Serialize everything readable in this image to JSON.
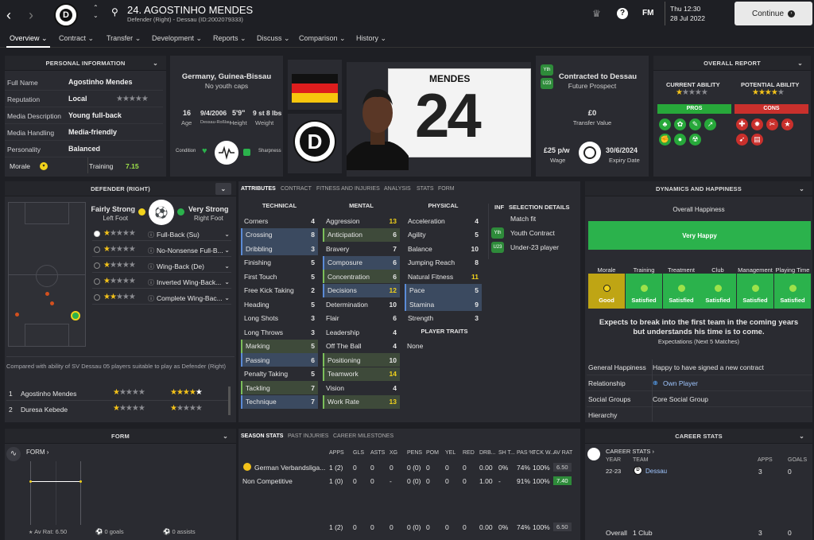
{
  "header": {
    "player_title": "24. AGOSTINHO MENDES",
    "player_sub": "Defender (Right) - Dessau (ID:2002079333)",
    "fm_label": "FM",
    "date_day": "Thu 12:30",
    "date": "28 Jul 2022",
    "continue_label": "Continue"
  },
  "tabs": [
    "Overview",
    "Contract",
    "Transfer",
    "Development",
    "Reports",
    "Discuss",
    "Comparison",
    "History"
  ],
  "personal": {
    "title": "PERSONAL INFORMATION",
    "rows": [
      {
        "k": "Full Name",
        "v": "Agostinho Mendes"
      },
      {
        "k": "Reputation",
        "v": "Local"
      },
      {
        "k": "Media Description",
        "v": "Young full-back"
      },
      {
        "k": "Media Handling",
        "v": "Media-friendly"
      },
      {
        "k": "Personality",
        "v": "Balanced"
      }
    ],
    "reputation_stars": "★★★★★",
    "morale_label": "Morale",
    "training_label": "Training",
    "training_value": "7.15"
  },
  "bio": {
    "nation": "Germany, Guinea-Bissau",
    "caps": "No youth caps",
    "age": "16",
    "age_label": "Age",
    "dob": "9/4/2006",
    "dob_label": "Dessau-Roßlau",
    "height": "5'9\"",
    "height_label": "Height",
    "weight": "9 st 8 lbs",
    "weight_label": "Weight",
    "condition_label": "Condition",
    "sharpness_label": "Sharpness"
  },
  "shirt": {
    "name": "MENDES",
    "number": "24"
  },
  "contract": {
    "badge1": "Yth",
    "badge2": "U23",
    "title": "Contracted to Dessau",
    "sub": "Future Prospect",
    "value": "£0",
    "value_label": "Transfer Value",
    "wage": "£25 p/w",
    "wage_label": "Wage",
    "expiry": "30/6/2024",
    "expiry_label": "Expiry Date"
  },
  "report": {
    "title": "OVERALL REPORT",
    "ca_label": "CURRENT ABILITY",
    "ca_stars": "★★",
    "pa_label": "POTENTIAL ABILITY",
    "pa_stars": "★★★★★",
    "pros_label": "PROS",
    "cons_label": "CONS"
  },
  "position": {
    "title": "DEFENDER (RIGHT)",
    "left_foot_rating": "Fairly Strong",
    "left_foot_label": "Left Foot",
    "right_foot_rating": "Very Strong",
    "right_foot_label": "Right Foot",
    "roles": [
      {
        "stars": "★★★★★",
        "name": "Full-Back (Su)"
      },
      {
        "stars": "★★★★★",
        "name": "No-Nonsense Full-B..."
      },
      {
        "stars": "★★★★★",
        "name": "Wing-Back (De)"
      },
      {
        "stars": "★★★★★",
        "name": "Inverted Wing-Back..."
      },
      {
        "stars": "★★★★★",
        "name": "Complete Wing-Bac..."
      }
    ],
    "compare_text": "Compared with ability of SV Dessau 05 players suitable to play as Defender (Right)",
    "compare_rows": [
      {
        "rank": "1",
        "name": "Agostinho Mendes",
        "ca": "★★★★★",
        "pa": "★★★★★"
      },
      {
        "rank": "2",
        "name": "Duresa Kebede",
        "ca": "★★★★★",
        "pa": "★★★★★"
      }
    ]
  },
  "attr_tabs": [
    "ATTRIBUTES",
    "CONTRACT",
    "FITNESS AND INJURIES",
    "ANALYSIS",
    "STATS",
    "FORM"
  ],
  "attributes": {
    "technical_label": "TECHNICAL",
    "mental_label": "MENTAL",
    "physical_label": "PHYSICAL",
    "technical": [
      {
        "n": "Corners",
        "v": "4",
        "h": ""
      },
      {
        "n": "Crossing",
        "v": "8",
        "h": "blue"
      },
      {
        "n": "Dribbling",
        "v": "3",
        "h": "blue"
      },
      {
        "n": "Finishing",
        "v": "5",
        "h": ""
      },
      {
        "n": "First Touch",
        "v": "5",
        "h": ""
      },
      {
        "n": "Free Kick Taking",
        "v": "2",
        "h": ""
      },
      {
        "n": "Heading",
        "v": "5",
        "h": ""
      },
      {
        "n": "Long Shots",
        "v": "3",
        "h": ""
      },
      {
        "n": "Long Throws",
        "v": "3",
        "h": ""
      },
      {
        "n": "Marking",
        "v": "5",
        "h": "green"
      },
      {
        "n": "Passing",
        "v": "6",
        "h": "blue"
      },
      {
        "n": "Penalty Taking",
        "v": "5",
        "h": ""
      },
      {
        "n": "Tackling",
        "v": "7",
        "h": "green"
      },
      {
        "n": "Technique",
        "v": "7",
        "h": "blue"
      }
    ],
    "mental": [
      {
        "n": "Aggression",
        "v": "13",
        "h": "",
        "y": true
      },
      {
        "n": "Anticipation",
        "v": "6",
        "h": "green"
      },
      {
        "n": "Bravery",
        "v": "7",
        "h": ""
      },
      {
        "n": "Composure",
        "v": "6",
        "h": "blue"
      },
      {
        "n": "Concentration",
        "v": "6",
        "h": "green"
      },
      {
        "n": "Decisions",
        "v": "12",
        "h": "blue",
        "y": true
      },
      {
        "n": "Determination",
        "v": "10",
        "h": ""
      },
      {
        "n": "Flair",
        "v": "6",
        "h": ""
      },
      {
        "n": "Leadership",
        "v": "4",
        "h": ""
      },
      {
        "n": "Off The Ball",
        "v": "4",
        "h": ""
      },
      {
        "n": "Positioning",
        "v": "10",
        "h": "green"
      },
      {
        "n": "Teamwork",
        "v": "14",
        "h": "green",
        "y": true
      },
      {
        "n": "Vision",
        "v": "4",
        "h": ""
      },
      {
        "n": "Work Rate",
        "v": "13",
        "h": "green",
        "y": true
      }
    ],
    "physical": [
      {
        "n": "Acceleration",
        "v": "4",
        "h": ""
      },
      {
        "n": "Agility",
        "v": "5",
        "h": ""
      },
      {
        "n": "Balance",
        "v": "10",
        "h": ""
      },
      {
        "n": "Jumping Reach",
        "v": "8",
        "h": ""
      },
      {
        "n": "Natural Fitness",
        "v": "11",
        "h": "",
        "y": true
      },
      {
        "n": "Pace",
        "v": "5",
        "h": "blue"
      },
      {
        "n": "Stamina",
        "v": "9",
        "h": "blue"
      },
      {
        "n": "Strength",
        "v": "3",
        "h": ""
      }
    ],
    "player_traits_label": "PLAYER TRAITS",
    "traits_none": "None",
    "inf_label": "INF",
    "selection_label": "SELECTION DETAILS",
    "selection": [
      "Match fit",
      "Youth Contract",
      "Under-23 player"
    ],
    "selection_badges": [
      "",
      "Yth",
      "U23"
    ]
  },
  "dynamics": {
    "title": "DYNAMICS AND HAPPINESS",
    "overall_label": "Overall Happiness",
    "overall_value": "Very Happy",
    "cats": [
      {
        "label": "Morale",
        "value": "Good"
      },
      {
        "label": "Training",
        "value": "Satisfied"
      },
      {
        "label": "Treatment",
        "value": "Satisfied"
      },
      {
        "label": "Club",
        "value": "Satisfied"
      },
      {
        "label": "Management",
        "value": "Satisfied"
      },
      {
        "label": "Playing Time",
        "value": "Satisfied"
      }
    ],
    "expect1": "Expects to break into the first team in the coming years",
    "expect2": "but understands his time is to come.",
    "expect3": "Expectations (Next 5 Matches)",
    "rows": [
      {
        "k": "General Happiness",
        "v": "Happy to have signed a new contract"
      },
      {
        "k": "Relationship",
        "v": "Own Player"
      },
      {
        "k": "Social Groups",
        "v": "Core Social Group"
      },
      {
        "k": "Hierarchy",
        "v": ""
      }
    ]
  },
  "form": {
    "title": "FORM",
    "form_label": "FORM",
    "av_rat": "Av Rat: 6.50",
    "goals": "0 goals",
    "assists": "0 assists"
  },
  "season": {
    "tabs": [
      "SEASON STATS",
      "PAST INJURIES",
      "CAREER MILESTONES"
    ],
    "headers": [
      "APPS",
      "GLS",
      "ASTS",
      "XG",
      "PENS",
      "POM",
      "YEL",
      "RED",
      "DRB...",
      "SH T...",
      "PAS %",
      "TCK W...",
      "AV RAT"
    ],
    "rows": [
      {
        "comp": "German Verbandsliga...",
        "vals": [
          "1 (2)",
          "0",
          "0",
          "0",
          "0 (0)",
          "0",
          "0",
          "0",
          "0.00",
          "0%",
          "74%",
          "100%",
          "6.50"
        ]
      },
      {
        "comp": "Non Competitive",
        "vals": [
          "1 (0)",
          "0",
          "0",
          "-",
          "0 (0)",
          "0",
          "0",
          "0",
          "1.00",
          "-",
          "91%",
          "100%",
          "7.40"
        ]
      }
    ],
    "total": [
      "1 (2)",
      "0",
      "0",
      "0",
      "0 (0)",
      "0",
      "0",
      "0",
      "0.00",
      "0%",
      "74%",
      "100%",
      "6.50"
    ]
  },
  "career": {
    "title": "CAREER STATS",
    "label": "CAREER STATS",
    "year_h": "YEAR",
    "team_h": "TEAM",
    "apps_h": "APPS",
    "goals_h": "GOALS",
    "row": {
      "year": "22-23",
      "team": "Dessau",
      "apps": "3",
      "goals": "0"
    },
    "overall": {
      "label": "Overall",
      "clubs": "1 Club",
      "apps": "3",
      "goals": "0"
    }
  },
  "colors": {
    "accent_green": "#2bb24c",
    "pros": "#27a83a",
    "cons": "#c9302c",
    "yellow": "#f1d21b"
  }
}
